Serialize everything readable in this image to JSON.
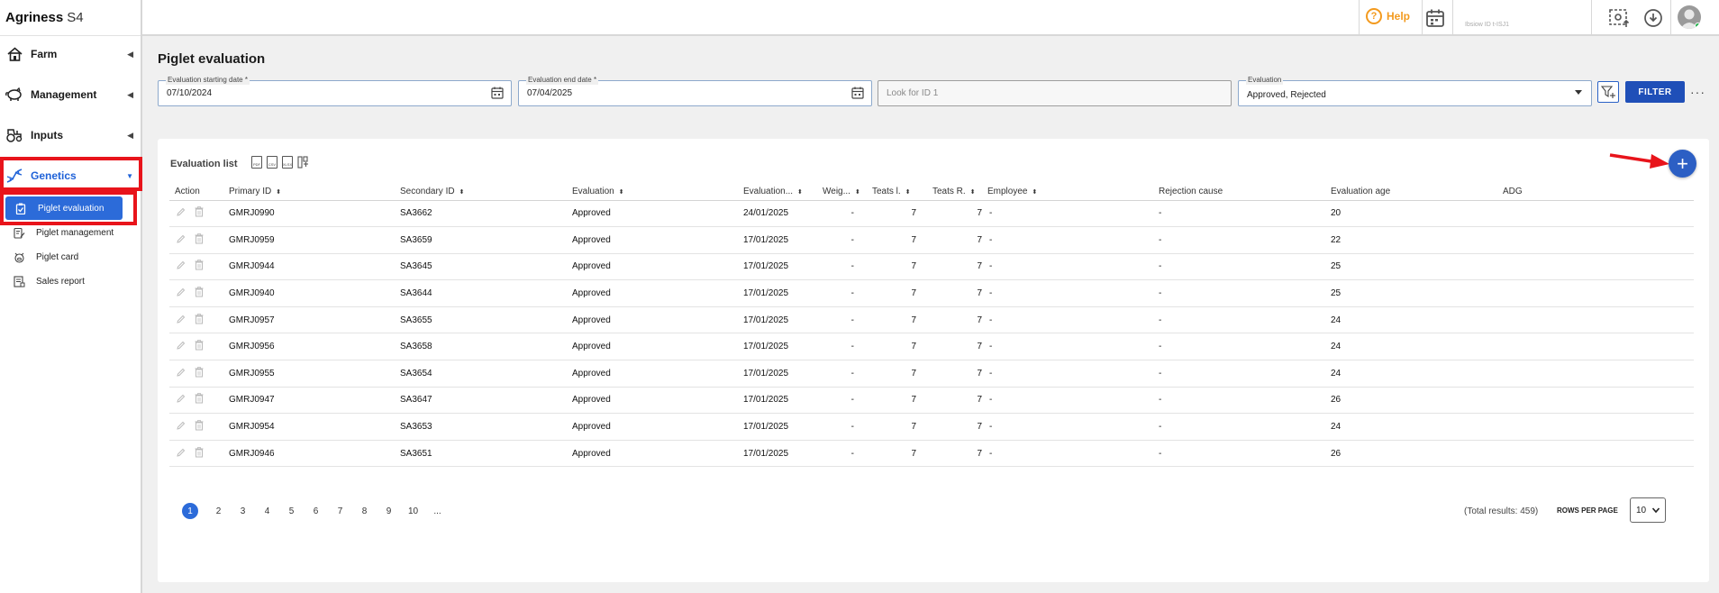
{
  "app": {
    "brand": "Agriness",
    "brand_suffix": "S4"
  },
  "sidebar": {
    "items": [
      {
        "label": "Farm",
        "icon": "farm-house-icon"
      },
      {
        "label": "Management",
        "icon": "pig-icon"
      },
      {
        "label": "Inputs",
        "icon": "tractor-icon"
      },
      {
        "label": "Genetics",
        "icon": "dna-icon"
      }
    ],
    "sub_items": [
      {
        "label": "Piglet evaluation",
        "icon": "clipboard-check-icon"
      },
      {
        "label": "Piglet management",
        "icon": "clipboard-edit-icon"
      },
      {
        "label": "Piglet card",
        "icon": "pig-card-icon"
      },
      {
        "label": "Sales report",
        "icon": "report-icon"
      }
    ]
  },
  "header": {
    "help_label": "Help",
    "faded_text": "Ibsiow ID t-ISJ1",
    "colors": {
      "help": "#f39a1e",
      "accent": "#1f4fb8",
      "highlight": "#e8141b"
    }
  },
  "page": {
    "title": "Piglet evaluation"
  },
  "filters": {
    "start_date": {
      "label": "Evaluation starting date *",
      "value": "07/10/2024"
    },
    "end_date": {
      "label": "Evaluation end date *",
      "value": "07/04/2025"
    },
    "look_for": {
      "placeholder": "Look for ID 1"
    },
    "evaluation": {
      "label": "Evaluation",
      "value": "Approved, Rejected"
    },
    "filter_button": "FILTER",
    "more": "···"
  },
  "list": {
    "title": "Evaluation list",
    "export_icons": [
      "PDF",
      "CSV",
      "XLSX"
    ],
    "columns": [
      "Action",
      "Primary ID",
      "Secondary ID",
      "Evaluation",
      "Evaluation...",
      "Weig...",
      "Teats l.",
      "Teats R.",
      "Employee",
      "Rejection cause",
      "Evaluation age",
      "ADG"
    ],
    "rows": [
      [
        "GMRJ0990",
        "SA3662",
        "Approved",
        "24/01/2025",
        "-",
        "7",
        "7",
        "-",
        "-",
        "20",
        ""
      ],
      [
        "GMRJ0959",
        "SA3659",
        "Approved",
        "17/01/2025",
        "-",
        "7",
        "7",
        "-",
        "-",
        "22",
        ""
      ],
      [
        "GMRJ0944",
        "SA3645",
        "Approved",
        "17/01/2025",
        "-",
        "7",
        "7",
        "-",
        "-",
        "25",
        ""
      ],
      [
        "GMRJ0940",
        "SA3644",
        "Approved",
        "17/01/2025",
        "-",
        "7",
        "7",
        "-",
        "-",
        "25",
        ""
      ],
      [
        "GMRJ0957",
        "SA3655",
        "Approved",
        "17/01/2025",
        "-",
        "7",
        "7",
        "-",
        "-",
        "24",
        ""
      ],
      [
        "GMRJ0956",
        "SA3658",
        "Approved",
        "17/01/2025",
        "-",
        "7",
        "7",
        "-",
        "-",
        "24",
        ""
      ],
      [
        "GMRJ0955",
        "SA3654",
        "Approved",
        "17/01/2025",
        "-",
        "7",
        "7",
        "-",
        "-",
        "24",
        ""
      ],
      [
        "GMRJ0947",
        "SA3647",
        "Approved",
        "17/01/2025",
        "-",
        "7",
        "7",
        "-",
        "-",
        "26",
        ""
      ],
      [
        "GMRJ0954",
        "SA3653",
        "Approved",
        "17/01/2025",
        "-",
        "7",
        "7",
        "-",
        "-",
        "24",
        ""
      ],
      [
        "GMRJ0946",
        "SA3651",
        "Approved",
        "17/01/2025",
        "-",
        "7",
        "7",
        "-",
        "-",
        "26",
        ""
      ]
    ]
  },
  "pagination": {
    "pages": [
      "1",
      "2",
      "3",
      "4",
      "5",
      "6",
      "7",
      "8",
      "9",
      "10",
      "..."
    ],
    "current": "1",
    "total_text": "(Total results: 459)",
    "rows_per_page_label": "ROWS PER PAGE",
    "rows_per_page": "10"
  }
}
